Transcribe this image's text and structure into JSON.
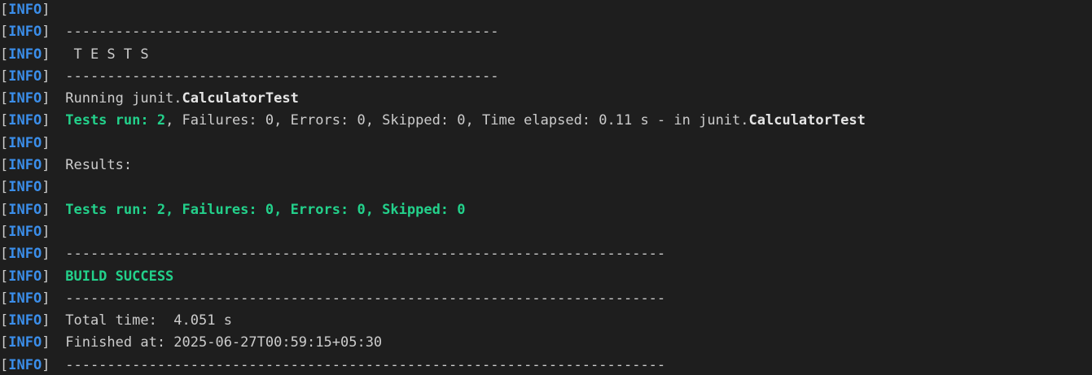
{
  "terminal": {
    "tag_open": "[",
    "tag_text": "INFO",
    "tag_close": "]",
    "lines": [
      {
        "segments": []
      },
      {
        "segments": [
          {
            "text": " ----------------------------------------------------",
            "style": "plain"
          }
        ]
      },
      {
        "segments": [
          {
            "text": "  T E S T S",
            "style": "plain"
          }
        ]
      },
      {
        "segments": [
          {
            "text": " ----------------------------------------------------",
            "style": "plain"
          }
        ]
      },
      {
        "segments": [
          {
            "text": " Running junit.",
            "style": "plain"
          },
          {
            "text": "CalculatorTest",
            "style": "bold"
          }
        ]
      },
      {
        "segments": [
          {
            "text": " Tests run: 2",
            "style": "green"
          },
          {
            "text": ", Failures: 0, Errors: 0, Skipped: 0, Time elapsed: 0.11 s - in junit.",
            "style": "plain"
          },
          {
            "text": "CalculatorTest",
            "style": "bold"
          }
        ]
      },
      {
        "segments": []
      },
      {
        "segments": [
          {
            "text": " Results:",
            "style": "plain"
          }
        ]
      },
      {
        "segments": []
      },
      {
        "segments": [
          {
            "text": " Tests run: 2, Failures: 0, Errors: 0, Skipped: 0",
            "style": "green"
          }
        ]
      },
      {
        "segments": []
      },
      {
        "segments": [
          {
            "text": " ------------------------------------------------------------------------",
            "style": "plain"
          }
        ]
      },
      {
        "segments": [
          {
            "text": " BUILD SUCCESS",
            "style": "green"
          }
        ]
      },
      {
        "segments": [
          {
            "text": " ------------------------------------------------------------------------",
            "style": "plain"
          }
        ]
      },
      {
        "segments": [
          {
            "text": " Total time:  4.051 s",
            "style": "plain"
          }
        ]
      },
      {
        "segments": [
          {
            "text": " Finished at: 2025-06-27T00:59:15+05:30",
            "style": "plain"
          }
        ]
      },
      {
        "segments": [
          {
            "text": " ------------------------------------------------------------------------",
            "style": "plain"
          }
        ]
      }
    ]
  }
}
